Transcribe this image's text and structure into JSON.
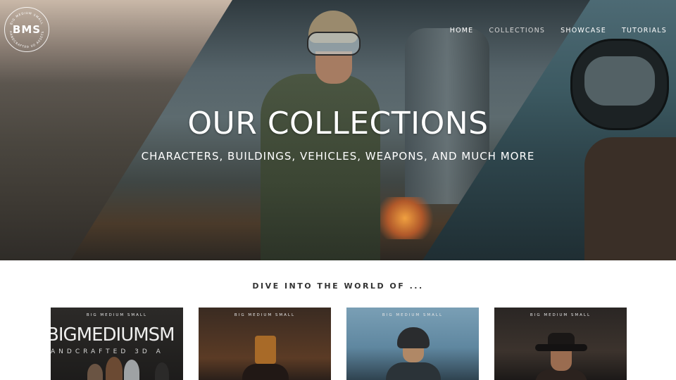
{
  "brand": {
    "logo_text": "BMS",
    "logo_ring_top": "BIG MEDIUM SMALL",
    "logo_ring_bottom": "HANDCRAFTED 3D ASSETS"
  },
  "nav": {
    "items": [
      {
        "label": "HOME"
      },
      {
        "label": "COLLECTIONS",
        "active": true
      },
      {
        "label": "SHOWCASE"
      },
      {
        "label": "TUTORIALS"
      }
    ]
  },
  "hero": {
    "title": "OUR COLLECTIONS",
    "subtitle": "CHARACTERS, BUILDINGS, VEHICLES, WEAPONS, AND MUCH MORE"
  },
  "section": {
    "heading": "DIVE INTO THE WORLD OF ..."
  },
  "cards": [
    {
      "brand": "BIG MEDIUM SMALL",
      "title": "BIGMEDIUMSM",
      "subtitle": "ANDCRAFTED 3D A"
    },
    {
      "brand": "BIG MEDIUM SMALL"
    },
    {
      "brand": "BIG MEDIUM SMALL"
    },
    {
      "brand": "BIG MEDIUM SMALL"
    }
  ]
}
